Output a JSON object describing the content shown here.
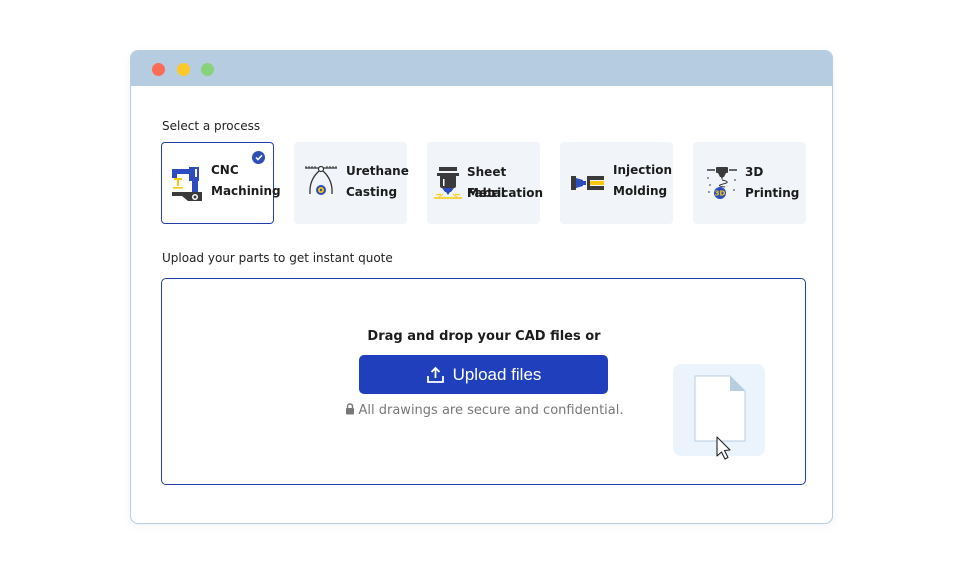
{
  "window": {
    "controls": [
      "close",
      "minimize",
      "maximize"
    ]
  },
  "process_section": {
    "label": "Select a process",
    "selected": "CNC Machining",
    "options": [
      {
        "line1": "CNC",
        "line2": "Machining",
        "icon": "cnc-machine-icon",
        "selected": true
      },
      {
        "line1": "Urethane",
        "line2": "Casting",
        "icon": "urethane-casting-icon",
        "selected": false
      },
      {
        "line1": "Sheet Metal",
        "line2": "Fabrication",
        "icon": "sheet-metal-icon",
        "selected": false
      },
      {
        "line1": "Injection",
        "line2": "Molding",
        "icon": "injection-molding-icon",
        "selected": false
      },
      {
        "line1": "3D",
        "line2": "Printing",
        "icon": "3d-printer-icon",
        "selected": false
      }
    ]
  },
  "upload_section": {
    "label": "Upload your parts to get instant quote",
    "drag_text": "Drag and drop your CAD files or",
    "button_label": "Upload files",
    "secure_note": "All drawings are secure and confidential."
  },
  "colors": {
    "accent": "#1f3fbd",
    "titlebar": "#b6cde1",
    "card_bg": "#f1f4f8",
    "yellow": "#f7c90a"
  }
}
